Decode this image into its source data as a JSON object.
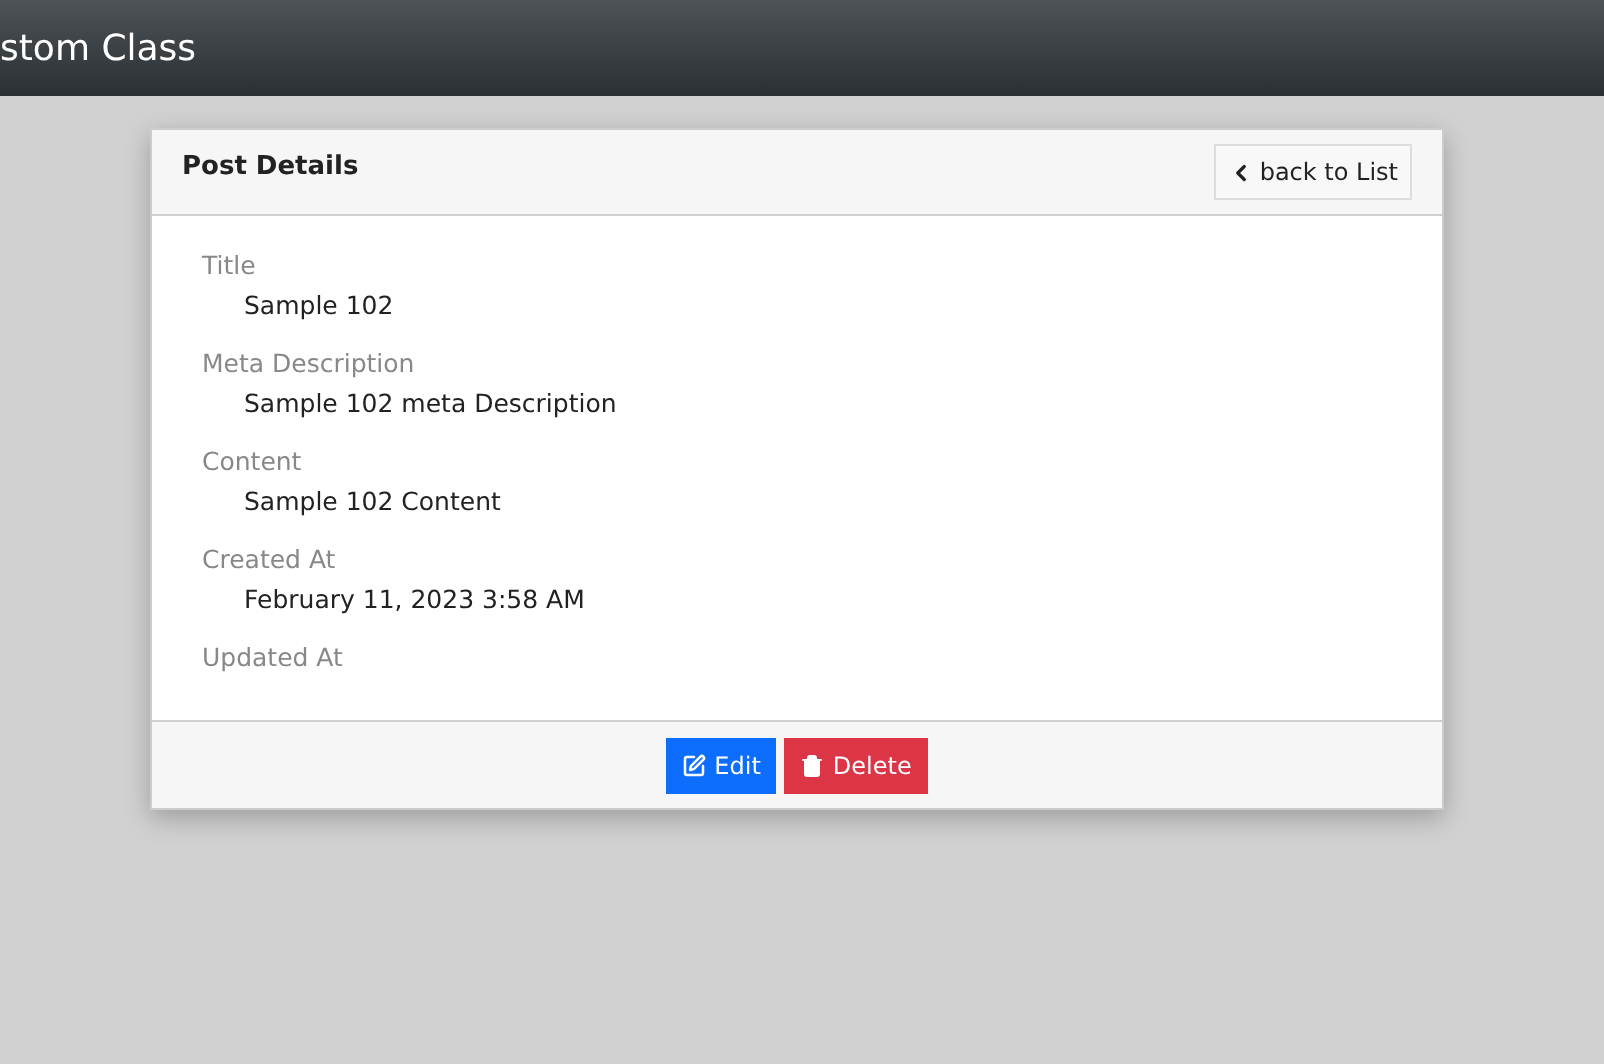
{
  "navbar": {
    "title": "stom Class"
  },
  "card": {
    "title": "Post Details",
    "back_button": "back to List",
    "fields": [
      {
        "label": "Title",
        "value": "Sample 102"
      },
      {
        "label": "Meta Description",
        "value": "Sample 102 meta Description"
      },
      {
        "label": "Content",
        "value": "Sample 102 Content"
      },
      {
        "label": "Created At",
        "value": "February 11, 2023 3:58 AM"
      },
      {
        "label": "Updated At"
      }
    ],
    "buttons": [
      {
        "label": "Edit",
        "kind": "edit"
      },
      {
        "label": "Delete",
        "kind": "delete"
      }
    ]
  }
}
